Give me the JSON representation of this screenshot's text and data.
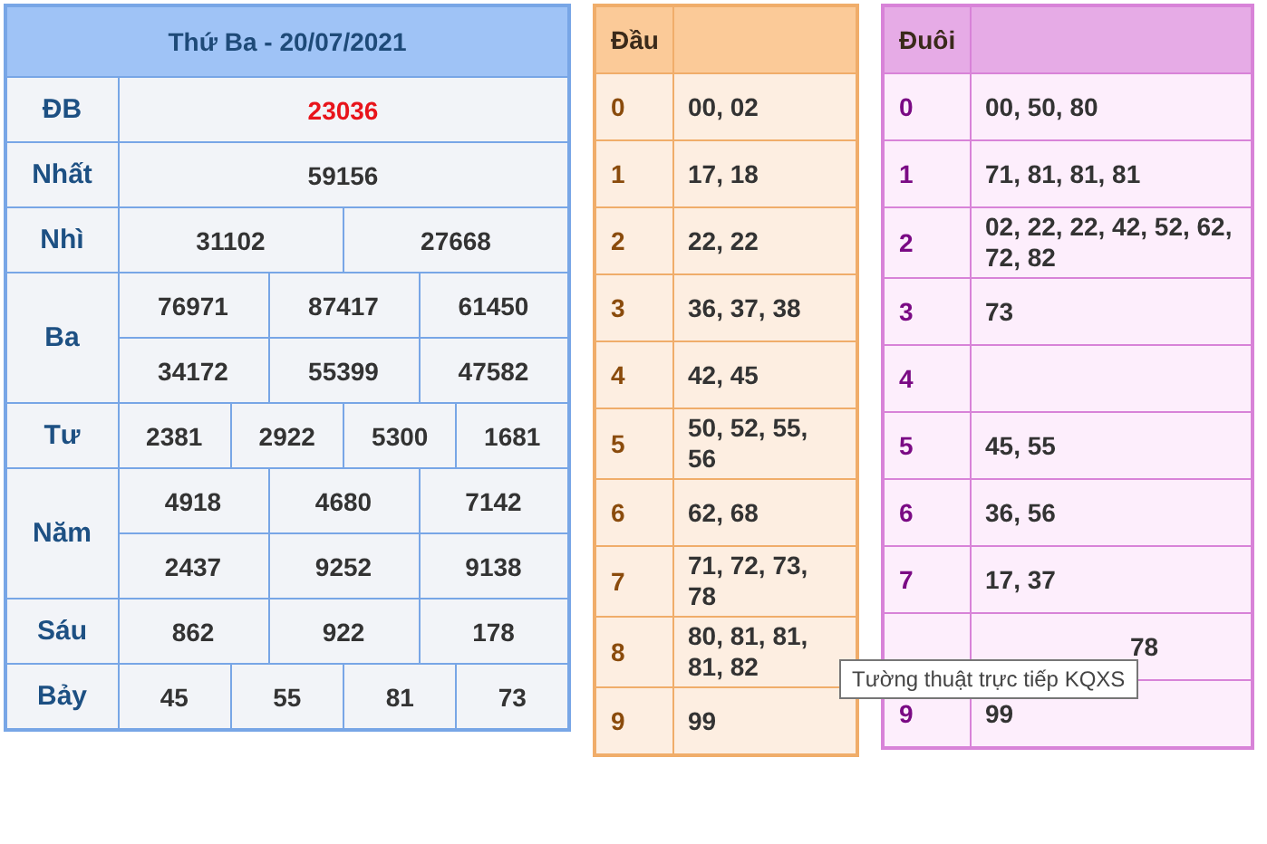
{
  "results": {
    "title": "Thứ Ba - 20/07/2021",
    "prizes": [
      {
        "label": "ĐB",
        "kind": "special",
        "lines": [
          [
            "23036"
          ]
        ]
      },
      {
        "label": "Nhất",
        "kind": "normal",
        "lines": [
          [
            "59156"
          ]
        ]
      },
      {
        "label": "Nhì",
        "kind": "normal",
        "lines": [
          [
            "31102",
            "27668"
          ]
        ]
      },
      {
        "label": "Ba",
        "kind": "normal",
        "lines": [
          [
            "76971",
            "87417",
            "61450"
          ],
          [
            "34172",
            "55399",
            "47582"
          ]
        ]
      },
      {
        "label": "Tư",
        "kind": "normal",
        "lines": [
          [
            "2381",
            "2922",
            "5300",
            "1681"
          ]
        ]
      },
      {
        "label": "Năm",
        "kind": "normal",
        "lines": [
          [
            "4918",
            "4680",
            "7142"
          ],
          [
            "2437",
            "9252",
            "9138"
          ]
        ]
      },
      {
        "label": "Sáu",
        "kind": "normal",
        "lines": [
          [
            "862",
            "922",
            "178"
          ]
        ]
      },
      {
        "label": "Bảy",
        "kind": "normal",
        "lines": [
          [
            "45",
            "55",
            "81",
            "73"
          ]
        ]
      }
    ]
  },
  "head_table": {
    "heading": "Đầu",
    "rows": [
      {
        "key": "0",
        "value": "00, 02"
      },
      {
        "key": "1",
        "value": "17, 18"
      },
      {
        "key": "2",
        "value": "22, 22"
      },
      {
        "key": "3",
        "value": "36, 37, 38"
      },
      {
        "key": "4",
        "value": "42, 45"
      },
      {
        "key": "5",
        "value": "50, 52, 55, 56"
      },
      {
        "key": "6",
        "value": "62, 68"
      },
      {
        "key": "7",
        "value": "71, 72, 73, 78"
      },
      {
        "key": "8",
        "value": "80, 81, 81, 81, 82"
      },
      {
        "key": "9",
        "value": "99"
      }
    ]
  },
  "tail_table": {
    "heading": "Đuôi",
    "rows": [
      {
        "key": "0",
        "value": "00, 50, 80"
      },
      {
        "key": "1",
        "value": "71, 81, 81, 81"
      },
      {
        "key": "2",
        "value": "02, 22, 22, 42, 52, 62, 72, 82"
      },
      {
        "key": "3",
        "value": "73"
      },
      {
        "key": "4",
        "value": ""
      },
      {
        "key": "5",
        "value": "45, 55"
      },
      {
        "key": "6",
        "value": "36, 56"
      },
      {
        "key": "7",
        "value": "17, 37"
      },
      {
        "kind": "covered",
        "value": "78"
      },
      {
        "key": "9",
        "value": "99"
      }
    ]
  },
  "tooltip": {
    "text": "Tường thuật trực tiếp KQXS"
  }
}
